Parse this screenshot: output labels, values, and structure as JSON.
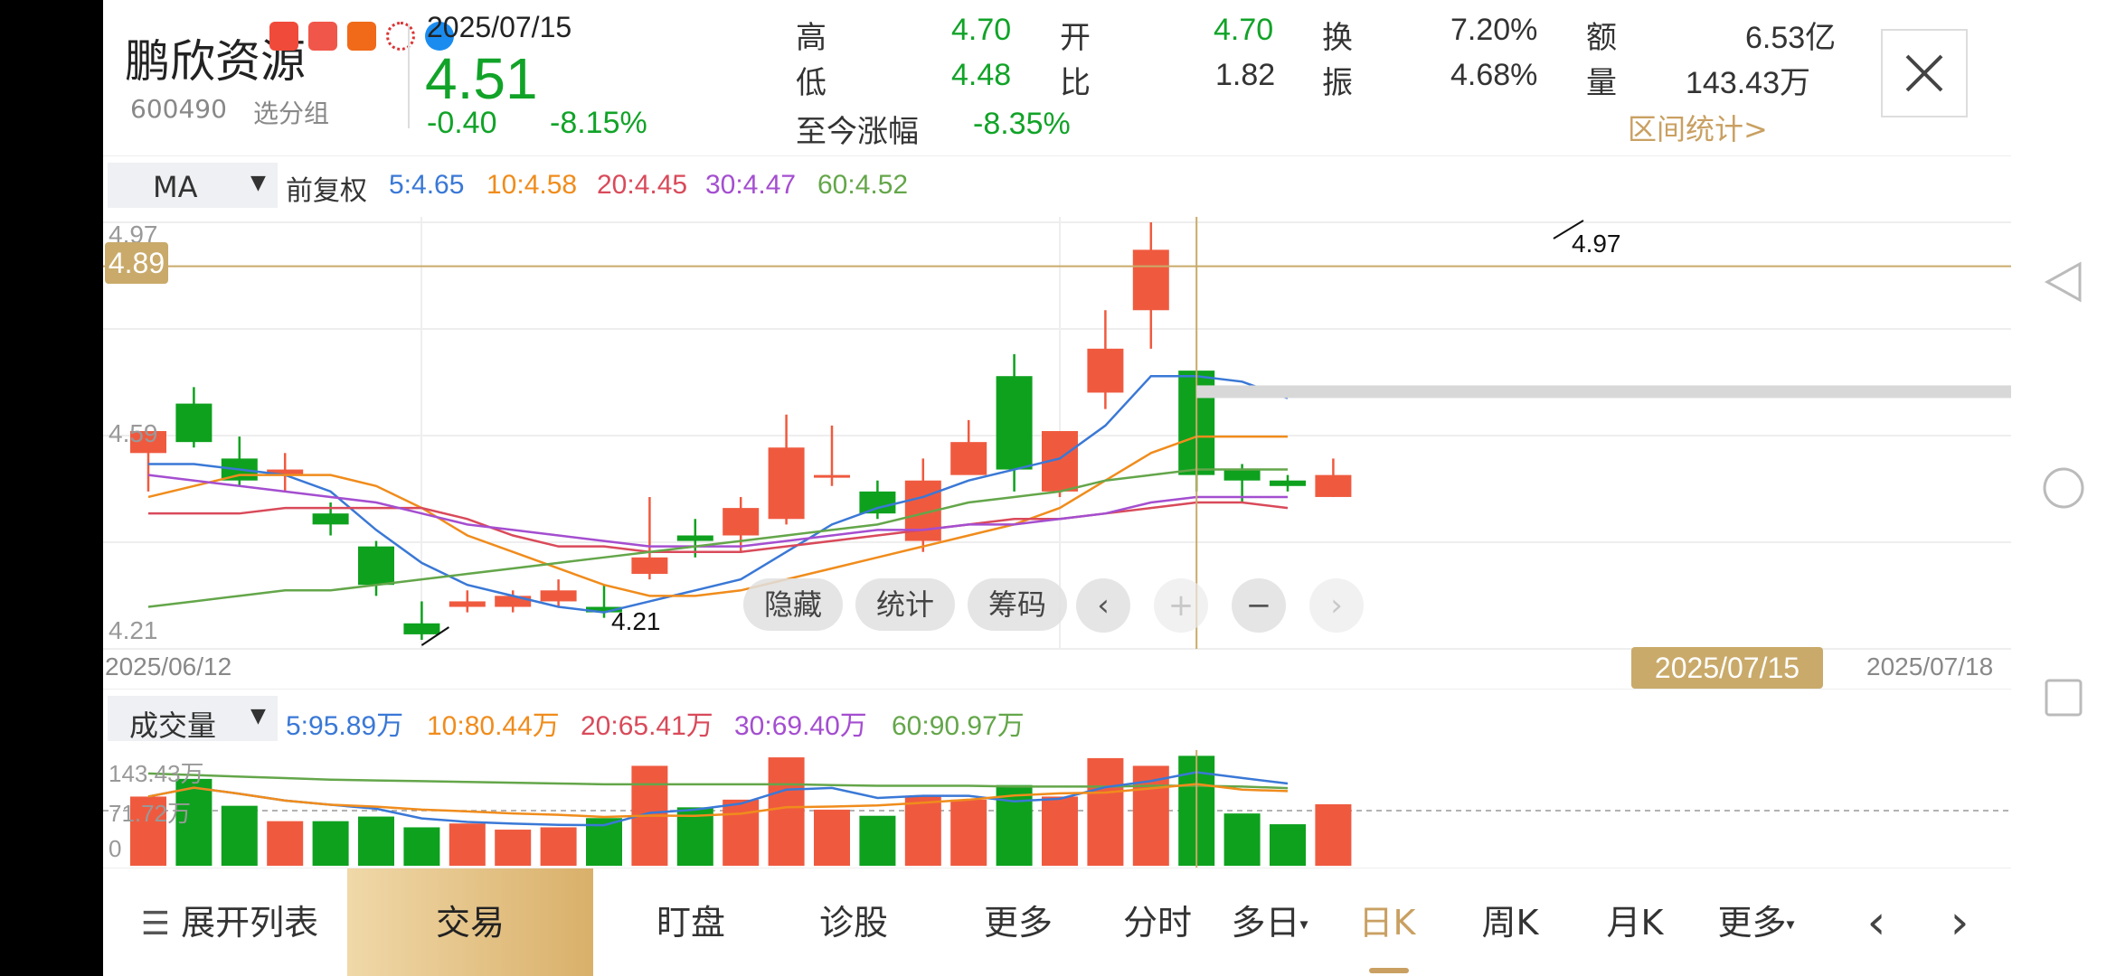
{
  "stock": {
    "name": "鹏欣资源",
    "code": "600490",
    "group": "选分组",
    "date": "2025/07/15",
    "price": "4.51",
    "change": "-0.40",
    "change_pct": "-8.15%"
  },
  "stats": {
    "high_label": "高",
    "high": "4.70",
    "open_label": "开",
    "open": "4.70",
    "turnover_label": "换",
    "turnover": "7.20%",
    "amount_label": "额",
    "amount": "6.53亿",
    "low_label": "低",
    "low": "4.48",
    "ratio_label": "比",
    "ratio": "1.82",
    "amplitude_label": "振",
    "amplitude": "4.68%",
    "volume_label": "量",
    "volume": "143.43万",
    "ytd_label": "至今涨幅",
    "ytd": "-8.35%",
    "range_stats": "区间统计>"
  },
  "ma_legend": {
    "selector": "MA",
    "adjust": "前复权",
    "ma5": "5:4.65",
    "ma10": "10:4.58",
    "ma20": "20:4.45",
    "ma30": "30:4.47",
    "ma60": "60:4.52"
  },
  "vol_legend": {
    "selector": "成交量",
    "v5": "5:95.89万",
    "v10": "10:80.44万",
    "v20": "20:65.41万",
    "v30": "30:69.40万",
    "v60": "60:90.97万"
  },
  "colors": {
    "up": "#ef5a3f",
    "down": "#0ea11e",
    "ma5": "#3a78d6",
    "ma10": "#f08c1c",
    "ma20": "#d94a5a",
    "ma30": "#a44ed0",
    "ma60": "#64a64a",
    "crosshair": "#c9aa6a"
  },
  "chart": {
    "y_top_label": "4.97",
    "y_mid_label": "4.59",
    "y_bottom_label": "4.21",
    "crosshair_price": "4.89",
    "crosshair_date": "2025/07/15",
    "start_date": "2025/06/12",
    "end_date": "2025/07/18",
    "max_label": "4.97",
    "min_label": "4.21",
    "vol_top_label": "143.43万",
    "vol_mid_label": "71.72万",
    "vol_zero_label": "0"
  },
  "overlay": {
    "hide": "隐藏",
    "stats": "统计",
    "chips": "筹码",
    "prev": "‹",
    "zoom_in": "+",
    "zoom_out": "−",
    "next": "›"
  },
  "bottom_tabs": {
    "expand": "展开列表",
    "trade": "交易",
    "watch": "盯盘",
    "diagnose": "诊股",
    "more": "更多",
    "intraday": "分时",
    "multiday": "多日",
    "day_k": "日K",
    "week_k": "周K",
    "month_k": "月K",
    "more2": "更多",
    "prev": "‹",
    "next": "›"
  },
  "chart_data": {
    "type": "candlestick",
    "y_range": [
      4.21,
      4.97
    ],
    "candles": [
      {
        "o": 4.55,
        "h": 4.57,
        "l": 4.48,
        "c": 4.59
      },
      {
        "o": 4.64,
        "h": 4.67,
        "l": 4.56,
        "c": 4.57
      },
      {
        "o": 4.54,
        "h": 4.58,
        "l": 4.49,
        "c": 4.5
      },
      {
        "o": 4.51,
        "h": 4.55,
        "l": 4.48,
        "c": 4.52
      },
      {
        "o": 4.44,
        "h": 4.46,
        "l": 4.4,
        "c": 4.42
      },
      {
        "o": 4.38,
        "h": 4.39,
        "l": 4.29,
        "c": 4.31
      },
      {
        "o": 4.24,
        "h": 4.28,
        "l": 4.21,
        "c": 4.22
      },
      {
        "o": 4.27,
        "h": 4.3,
        "l": 4.26,
        "c": 4.28
      },
      {
        "o": 4.27,
        "h": 4.3,
        "l": 4.26,
        "c": 4.29
      },
      {
        "o": 4.28,
        "h": 4.32,
        "l": 4.27,
        "c": 4.3
      },
      {
        "o": 4.27,
        "h": 4.31,
        "l": 4.25,
        "c": 4.26
      },
      {
        "o": 4.33,
        "h": 4.47,
        "l": 4.32,
        "c": 4.36
      },
      {
        "o": 4.4,
        "h": 4.43,
        "l": 4.36,
        "c": 4.39
      },
      {
        "o": 4.4,
        "h": 4.47,
        "l": 4.37,
        "c": 4.45
      },
      {
        "o": 4.43,
        "h": 4.62,
        "l": 4.42,
        "c": 4.56
      },
      {
        "o": 4.51,
        "h": 4.6,
        "l": 4.49,
        "c": 4.51
      },
      {
        "o": 4.48,
        "h": 4.5,
        "l": 4.43,
        "c": 4.44
      },
      {
        "o": 4.39,
        "h": 4.54,
        "l": 4.37,
        "c": 4.5
      },
      {
        "o": 4.51,
        "h": 4.61,
        "l": 4.52,
        "c": 4.57
      },
      {
        "o": 4.69,
        "h": 4.73,
        "l": 4.48,
        "c": 4.52
      },
      {
        "o": 4.48,
        "h": 4.59,
        "l": 4.47,
        "c": 4.59
      },
      {
        "o": 4.66,
        "h": 4.81,
        "l": 4.63,
        "c": 4.74
      },
      {
        "o": 4.81,
        "h": 4.97,
        "l": 4.74,
        "c": 4.92
      },
      {
        "o": 4.7,
        "h": 4.7,
        "l": 4.48,
        "c": 4.51
      },
      {
        "o": 4.52,
        "h": 4.53,
        "l": 4.46,
        "c": 4.5
      },
      {
        "o": 4.5,
        "h": 4.51,
        "l": 4.48,
        "c": 4.49
      },
      {
        "o": 4.47,
        "h": 4.54,
        "l": 4.47,
        "c": 4.51
      }
    ],
    "ma5": [
      4.53,
      4.53,
      4.52,
      4.51,
      4.48,
      4.41,
      4.35,
      4.31,
      4.29,
      4.27,
      4.26,
      4.28,
      4.3,
      4.32,
      4.37,
      4.42,
      4.45,
      4.47,
      4.5,
      4.52,
      4.54,
      4.6,
      4.69,
      4.69,
      4.68,
      4.65
    ],
    "ma10": [
      4.47,
      4.49,
      4.51,
      4.51,
      4.51,
      4.49,
      4.45,
      4.4,
      4.37,
      4.34,
      4.31,
      4.29,
      4.29,
      4.3,
      4.32,
      4.34,
      4.36,
      4.38,
      4.4,
      4.42,
      4.45,
      4.5,
      4.55,
      4.58,
      4.58,
      4.58
    ],
    "ma20": [
      4.44,
      4.44,
      4.44,
      4.45,
      4.45,
      4.45,
      4.45,
      4.43,
      4.4,
      4.38,
      4.38,
      4.37,
      4.37,
      4.37,
      4.38,
      4.39,
      4.4,
      4.41,
      4.42,
      4.43,
      4.43,
      4.44,
      4.45,
      4.46,
      4.46,
      4.45
    ],
    "ma30": [
      4.51,
      4.5,
      4.49,
      4.48,
      4.47,
      4.46,
      4.44,
      4.42,
      4.41,
      4.4,
      4.39,
      4.38,
      4.38,
      4.38,
      4.39,
      4.4,
      4.41,
      4.41,
      4.42,
      4.42,
      4.43,
      4.44,
      4.46,
      4.47,
      4.47,
      4.47
    ],
    "ma60": [
      4.27,
      4.28,
      4.29,
      4.3,
      4.3,
      4.31,
      4.32,
      4.33,
      4.34,
      4.35,
      4.36,
      4.37,
      4.38,
      4.39,
      4.4,
      4.41,
      4.42,
      4.44,
      4.46,
      4.47,
      4.48,
      4.5,
      4.51,
      4.52,
      4.52,
      4.52
    ],
    "volume_range": [
      0,
      143.43
    ],
    "volume": [
      90,
      113,
      78,
      58,
      58,
      64,
      50,
      55,
      47,
      50,
      62,
      130,
      76,
      86,
      141,
      73,
      65,
      90,
      86,
      105,
      90,
      140,
      130,
      143,
      68,
      54,
      80
    ],
    "vol_ma60": [
      120,
      118,
      116,
      114,
      112,
      111,
      110,
      109,
      108,
      107,
      106,
      106,
      106,
      106,
      106,
      105,
      104,
      104,
      104,
      103,
      103,
      103,
      104,
      104,
      103,
      101
    ]
  }
}
